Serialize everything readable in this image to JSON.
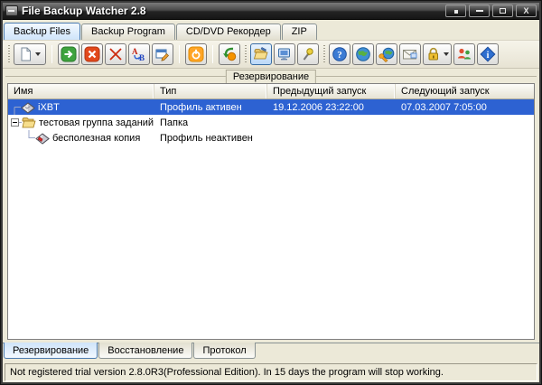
{
  "window": {
    "title": "File Backup Watcher 2.8",
    "controls": [
      "tray",
      "minimize",
      "maximize",
      "close"
    ]
  },
  "tabs_top": [
    {
      "label": "Backup Files",
      "active": true
    },
    {
      "label": "Backup Program",
      "active": false
    },
    {
      "label": "CD/DVD Рекордер",
      "active": false
    },
    {
      "label": "ZIP",
      "active": false
    }
  ],
  "toolbar": {
    "buttons": [
      "new-profile",
      "run",
      "stop",
      "delete",
      "rename",
      "properties",
      "power",
      "restore",
      "folder-edit",
      "computer",
      "pin",
      "help",
      "web",
      "web-tools",
      "mail",
      "lock",
      "users",
      "about"
    ],
    "active_button": "folder-edit"
  },
  "groupbox": {
    "legend": "Резервирование"
  },
  "table": {
    "columns": [
      "Имя",
      "Тип",
      "Предыдущий запуск",
      "Следующий запуск"
    ],
    "rows": [
      {
        "name": "iXBT",
        "type": "Профиль активен",
        "prev_run": "19.12.2006 23:22:00",
        "next_run": "07.03.2007 7:05:00",
        "selected": true,
        "icon": "profile-active-diamond-icon"
      },
      {
        "name": "тестовая группа заданий",
        "type": "Папка",
        "prev_run": "",
        "next_run": "",
        "selected": false,
        "icon": "folder-open-icon",
        "expander": "collapse"
      },
      {
        "name": "бесполезная копия",
        "type": "Профиль неактивен",
        "prev_run": "",
        "next_run": "",
        "selected": false,
        "icon": "profile-inactive-diamond-icon"
      }
    ]
  },
  "tabs_bottom": [
    {
      "label": "Резервирование",
      "active": true
    },
    {
      "label": "Восстановление",
      "active": false
    },
    {
      "label": "Протокол",
      "active": false
    }
  ],
  "statusbar": {
    "text": "Not registered trial version 2.8.0R3(Professional Edition). In 15 days the program will stop working."
  },
  "colors": {
    "selection": "#2d62d2",
    "titlebar_top": "#7a7a7a",
    "titlebar_bottom": "#161616",
    "active_tab": "#cfe4fa",
    "client_bg": "#ece9d8"
  }
}
